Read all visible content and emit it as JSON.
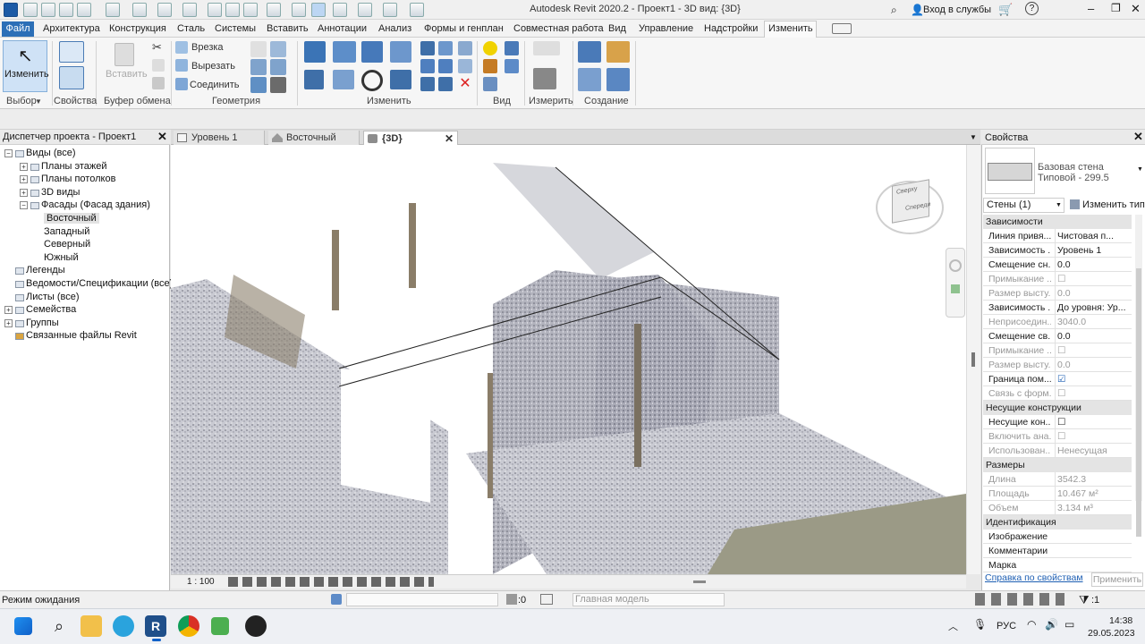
{
  "window": {
    "title": "Autodesk Revit 2020.2 - Проект1 - 3D вид: {3D}"
  },
  "account": {
    "signin": "Вход в службы"
  },
  "menu": {
    "file": "Файл",
    "items": [
      "Архитектура",
      "Конструкция",
      "Сталь",
      "Системы",
      "Вставить",
      "Аннотации",
      "Анализ",
      "Формы и генплан",
      "Совместная работа",
      "Вид",
      "Управление",
      "Надстройки",
      "Изменить"
    ]
  },
  "ribbon": {
    "modify_label": "Изменить",
    "paste_label": "Вставить",
    "cut_panel": {
      "cope": "Врезка",
      "cut": "Вырезать",
      "join": "Соединить"
    },
    "groups": [
      "Выбор",
      "Свойства",
      "Буфер обмена",
      "Геометрия",
      "Изменить",
      "Вид",
      "Измерить",
      "Создание"
    ]
  },
  "project_browser": {
    "title": "Диспетчер проекта - Проект1",
    "tree": [
      {
        "label": "Виды (все)",
        "level": 0,
        "toggle": "−"
      },
      {
        "label": "Планы этажей",
        "level": 1,
        "toggle": "+"
      },
      {
        "label": "Планы потолков",
        "level": 1,
        "toggle": "+"
      },
      {
        "label": "3D виды",
        "level": 1,
        "toggle": "+"
      },
      {
        "label": "Фасады (Фасад здания)",
        "level": 1,
        "toggle": "−"
      },
      {
        "label": "Восточный",
        "level": 2,
        "toggle": "",
        "selected": true
      },
      {
        "label": "Западный",
        "level": 2,
        "toggle": ""
      },
      {
        "label": "Северный",
        "level": 2,
        "toggle": ""
      },
      {
        "label": "Южный",
        "level": 2,
        "toggle": ""
      },
      {
        "label": "Легенды",
        "level": 0,
        "toggle": ""
      },
      {
        "label": "Ведомости/Спецификации (все)",
        "level": 0,
        "toggle": ""
      },
      {
        "label": "Листы (все)",
        "level": 0,
        "toggle": ""
      },
      {
        "label": "Семейства",
        "level": 0,
        "toggle": "+"
      },
      {
        "label": "Группы",
        "level": 0,
        "toggle": "+"
      },
      {
        "label": "Связанные файлы Revit",
        "level": 0,
        "toggle": ""
      }
    ]
  },
  "view_tabs": [
    {
      "label": "Уровень 1"
    },
    {
      "label": "Восточный"
    },
    {
      "label": "{3D}",
      "active": true
    }
  ],
  "viewcube": {
    "top": "Сверху",
    "front": "Спереди"
  },
  "view_bar": {
    "scale": "1 : 100"
  },
  "properties": {
    "title": "Свойства",
    "type_family": "Базовая стена",
    "type_name": "Типовой - 299.5",
    "filter": "Стены (1)",
    "edit_type": "Изменить тип",
    "sections": [
      {
        "name": "Зависимости",
        "rows": [
          {
            "name": "Линия привя...",
            "value": "Чистовая п...",
            "dim": false
          },
          {
            "name": "Зависимость ...",
            "value": "Уровень 1",
            "dim": false
          },
          {
            "name": "Смещение сн...",
            "value": "0.0",
            "dim": false
          },
          {
            "name": "Примыкание ...",
            "value": "☐",
            "dim": true
          },
          {
            "name": "Размер высту...",
            "value": "0.0",
            "dim": true
          },
          {
            "name": "Зависимость ...",
            "value": "До уровня: Ур...",
            "dim": false
          },
          {
            "name": "Неприсоедин...",
            "value": "3040.0",
            "dim": true
          },
          {
            "name": "Смещение св...",
            "value": "0.0",
            "dim": false
          },
          {
            "name": "Примыкание ...",
            "value": "☐",
            "dim": true
          },
          {
            "name": "Размер высту...",
            "value": "0.0",
            "dim": true
          },
          {
            "name": "Граница пом...",
            "value": "☑",
            "dim": false
          },
          {
            "name": "Связь с форм...",
            "value": "☐",
            "dim": true
          }
        ]
      },
      {
        "name": "Несущие конструкции",
        "rows": [
          {
            "name": "Несущие кон...",
            "value": "☐",
            "dim": false
          },
          {
            "name": "Включить ана...",
            "value": "☐",
            "dim": true
          },
          {
            "name": "Использован...",
            "value": "Ненесущая",
            "dim": true
          }
        ]
      },
      {
        "name": "Размеры",
        "rows": [
          {
            "name": "Длина",
            "value": "3542.3",
            "dim": true
          },
          {
            "name": "Площадь",
            "value": "10.467 м²",
            "dim": true
          },
          {
            "name": "Объем",
            "value": "3.134 м³",
            "dim": true
          }
        ]
      },
      {
        "name": "Идентификация",
        "rows": [
          {
            "name": "Изображение",
            "value": "",
            "dim": false
          },
          {
            "name": "Комментарии",
            "value": "",
            "dim": false
          },
          {
            "name": "Марка",
            "value": "",
            "dim": false
          }
        ]
      }
    ],
    "help_link": "Справка по свойствам",
    "apply": "Применить"
  },
  "status": {
    "text": "Режим ожидания",
    "sel_count": ":0",
    "model": "Главная модель",
    "filter_count": ":1"
  },
  "taskbar": {
    "lang": "РУС",
    "time": "14:38",
    "date": "29.05.2023"
  }
}
